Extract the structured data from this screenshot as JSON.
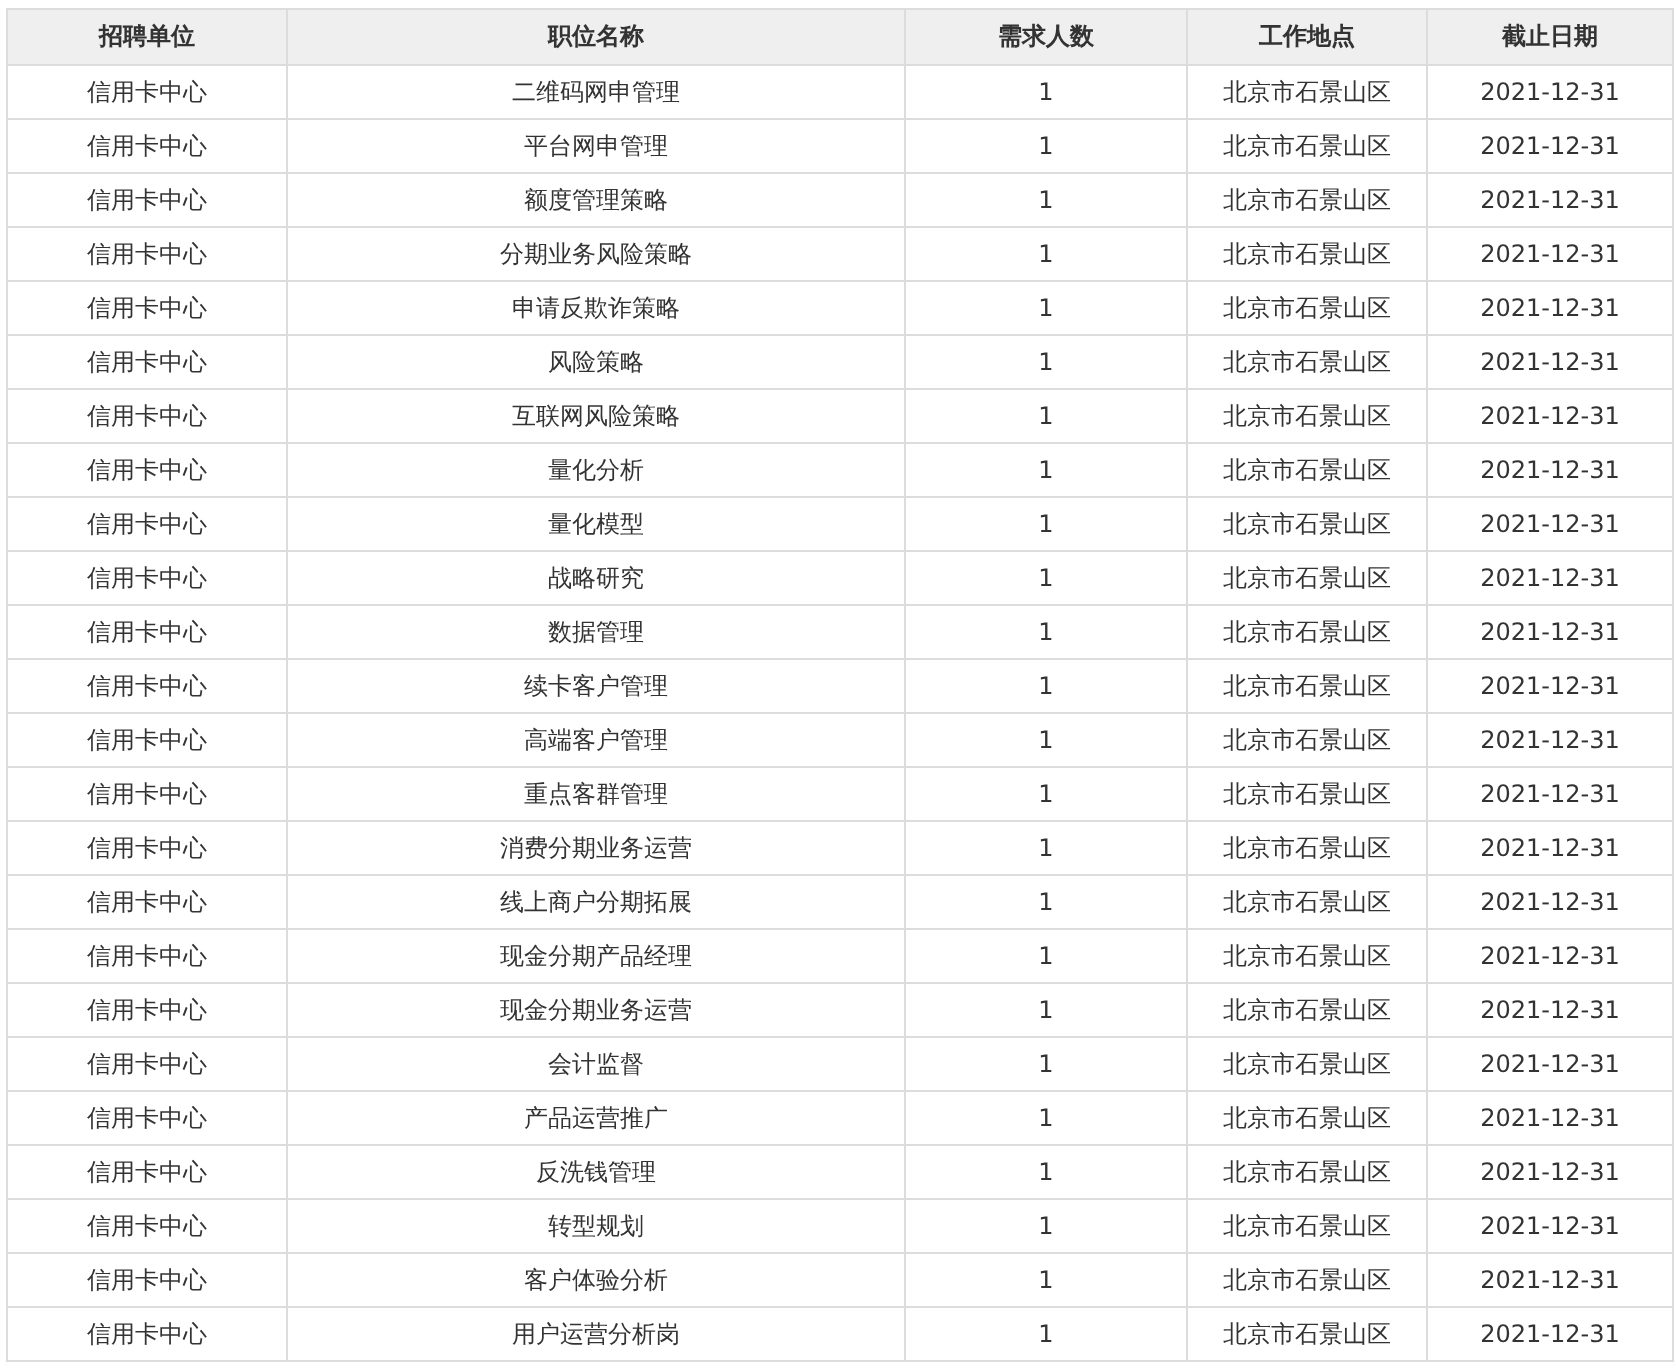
{
  "table": {
    "columns": [
      "招聘单位",
      "职位名称",
      "需求人数",
      "工作地点",
      "截止日期"
    ],
    "rows": [
      [
        "信用卡中心",
        "二维码网申管理",
        "1",
        "北京市石景山区",
        "2021-12-31"
      ],
      [
        "信用卡中心",
        "平台网申管理",
        "1",
        "北京市石景山区",
        "2021-12-31"
      ],
      [
        "信用卡中心",
        "额度管理策略",
        "1",
        "北京市石景山区",
        "2021-12-31"
      ],
      [
        "信用卡中心",
        "分期业务风险策略",
        "1",
        "北京市石景山区",
        "2021-12-31"
      ],
      [
        "信用卡中心",
        "申请反欺诈策略",
        "1",
        "北京市石景山区",
        "2021-12-31"
      ],
      [
        "信用卡中心",
        "风险策略",
        "1",
        "北京市石景山区",
        "2021-12-31"
      ],
      [
        "信用卡中心",
        "互联网风险策略",
        "1",
        "北京市石景山区",
        "2021-12-31"
      ],
      [
        "信用卡中心",
        "量化分析",
        "1",
        "北京市石景山区",
        "2021-12-31"
      ],
      [
        "信用卡中心",
        "量化模型",
        "1",
        "北京市石景山区",
        "2021-12-31"
      ],
      [
        "信用卡中心",
        "战略研究",
        "1",
        "北京市石景山区",
        "2021-12-31"
      ],
      [
        "信用卡中心",
        "数据管理",
        "1",
        "北京市石景山区",
        "2021-12-31"
      ],
      [
        "信用卡中心",
        "续卡客户管理",
        "1",
        "北京市石景山区",
        "2021-12-31"
      ],
      [
        "信用卡中心",
        "高端客户管理",
        "1",
        "北京市石景山区",
        "2021-12-31"
      ],
      [
        "信用卡中心",
        "重点客群管理",
        "1",
        "北京市石景山区",
        "2021-12-31"
      ],
      [
        "信用卡中心",
        "消费分期业务运营",
        "1",
        "北京市石景山区",
        "2021-12-31"
      ],
      [
        "信用卡中心",
        "线上商户分期拓展",
        "1",
        "北京市石景山区",
        "2021-12-31"
      ],
      [
        "信用卡中心",
        "现金分期产品经理",
        "1",
        "北京市石景山区",
        "2021-12-31"
      ],
      [
        "信用卡中心",
        "现金分期业务运营",
        "1",
        "北京市石景山区",
        "2021-12-31"
      ],
      [
        "信用卡中心",
        "会计监督",
        "1",
        "北京市石景山区",
        "2021-12-31"
      ],
      [
        "信用卡中心",
        "产品运营推广",
        "1",
        "北京市石景山区",
        "2021-12-31"
      ],
      [
        "信用卡中心",
        "反洗钱管理",
        "1",
        "北京市石景山区",
        "2021-12-31"
      ],
      [
        "信用卡中心",
        "转型规划",
        "1",
        "北京市石景山区",
        "2021-12-31"
      ],
      [
        "信用卡中心",
        "客户体验分析",
        "1",
        "北京市石景山区",
        "2021-12-31"
      ],
      [
        "信用卡中心",
        "用户运营分析岗",
        "1",
        "北京市石景山区",
        "2021-12-31"
      ]
    ]
  }
}
